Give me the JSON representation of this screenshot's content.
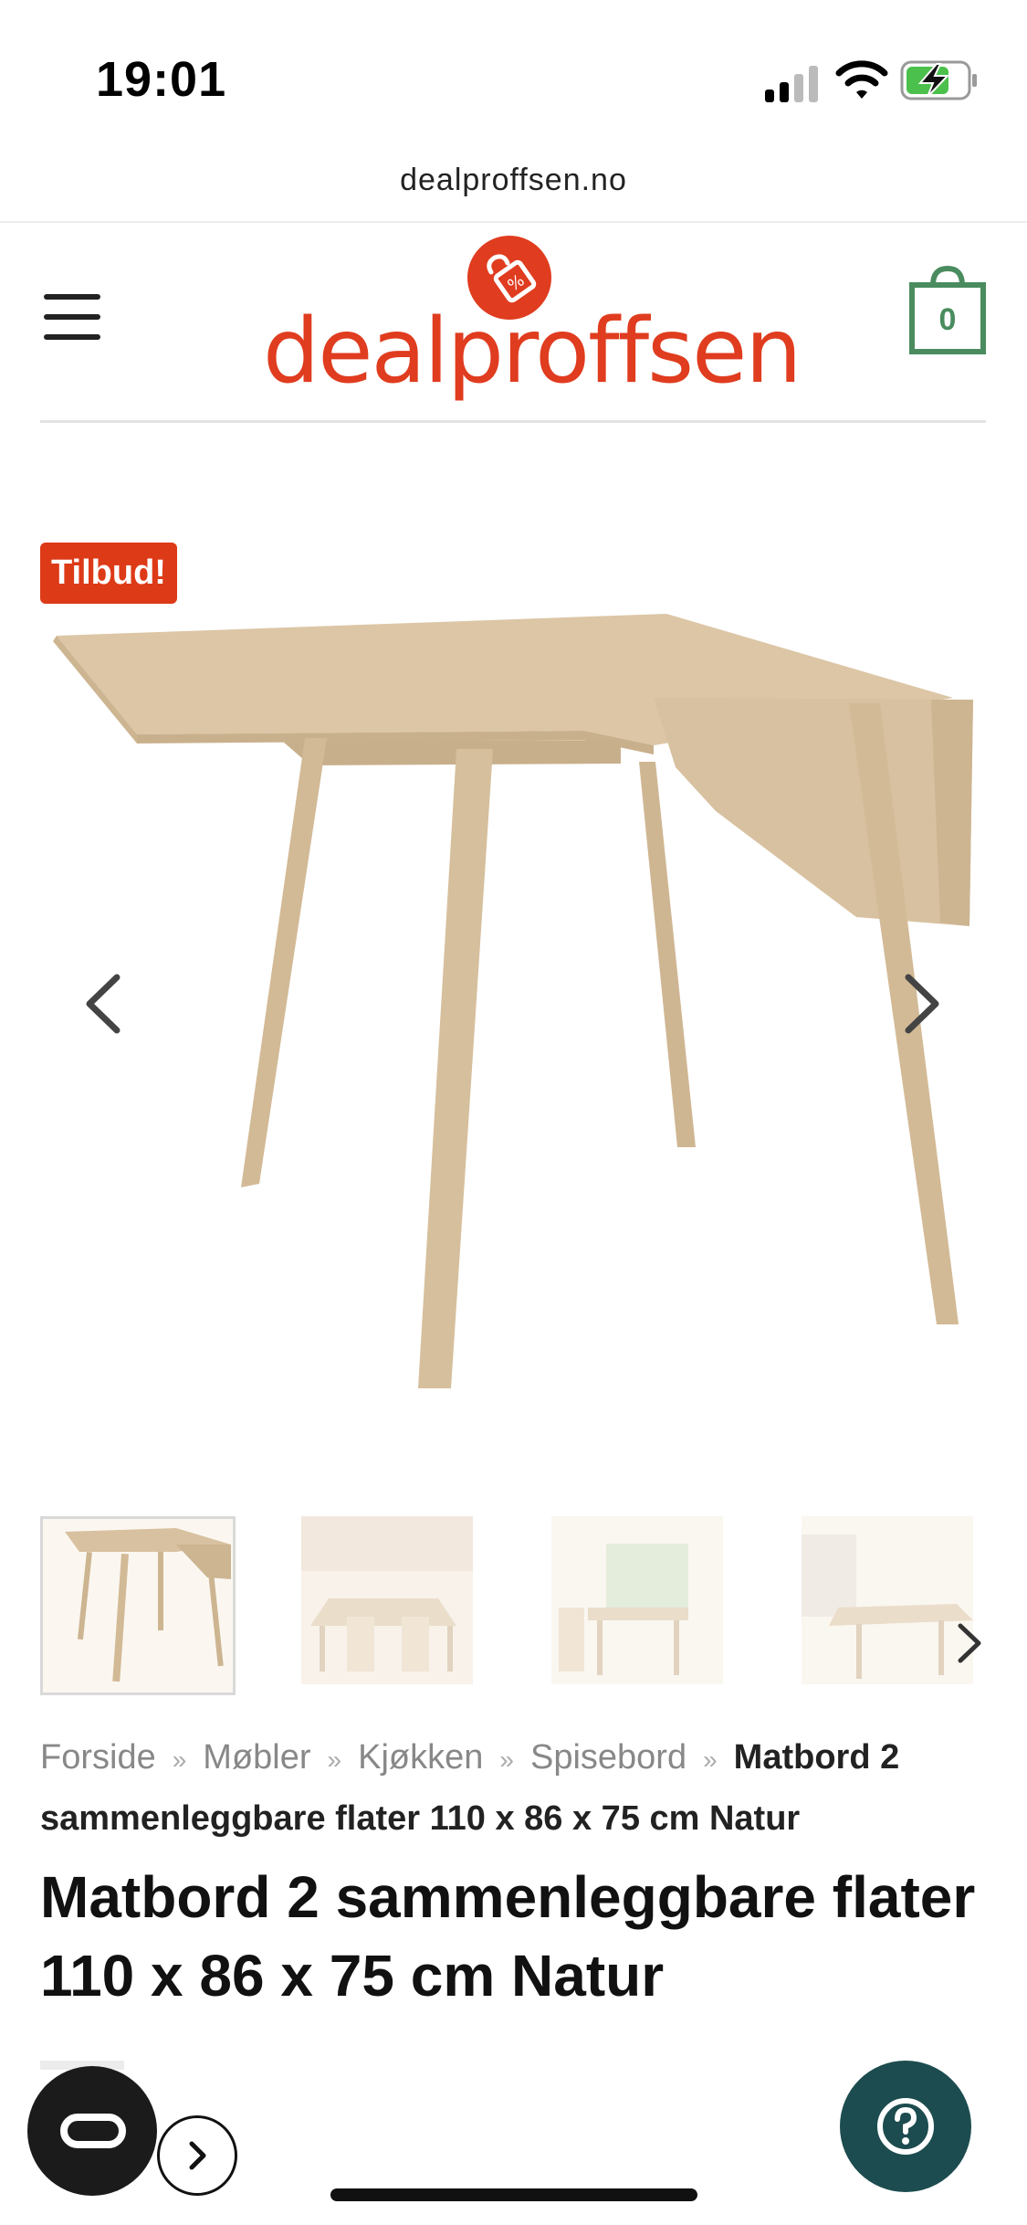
{
  "status_bar": {
    "time": "19:01",
    "icons": [
      "signal-icon",
      "wifi-icon",
      "battery-charging-icon"
    ]
  },
  "browser": {
    "url": "dealproffsen.no"
  },
  "header": {
    "logo_text": "dealproffsen",
    "cart_count": "0",
    "icons": [
      "menu-icon",
      "logo-tag-icon",
      "cart-bag-icon"
    ]
  },
  "product": {
    "badge": "Tilbud!",
    "title": "Matbord 2 sammenleggbare flater 110 x 86 x 75 cm Natur",
    "image_alt": "Matbord",
    "thumbnail_count": 4
  },
  "breadcrumb": {
    "items": [
      "Forside",
      "Møbler",
      "Kjøkken",
      "Spisebord"
    ],
    "separator": "»",
    "current": "Matbord 2 sammenleggbare flater 110 x 86 x 75 cm Natur"
  },
  "colors": {
    "brand": "#e03c1f",
    "badge": "#dd3a17",
    "cart": "#4a8c5f",
    "help_button": "#1c4c4f"
  }
}
